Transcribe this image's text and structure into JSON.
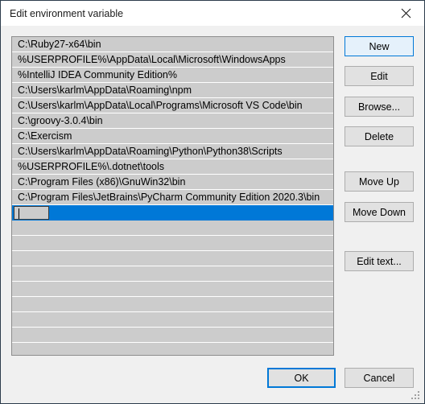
{
  "window": {
    "title": "Edit environment variable",
    "close_icon": "close-icon"
  },
  "path_list": {
    "entries": [
      "C:\\Ruby27-x64\\bin",
      "%USERPROFILE%\\AppData\\Local\\Microsoft\\WindowsApps",
      "%IntelliJ IDEA Community Edition%",
      "C:\\Users\\karlm\\AppData\\Roaming\\npm",
      "C:\\Users\\karlm\\AppData\\Local\\Programs\\Microsoft VS Code\\bin",
      "C:\\groovy-3.0.4\\bin",
      "C:\\Exercism",
      "C:\\Users\\karlm\\AppData\\Roaming\\Python\\Python38\\Scripts",
      "%USERPROFILE%\\.dotnet\\tools",
      "C:\\Program Files (x86)\\GnuWin32\\bin",
      "C:\\Program Files\\JetBrains\\PyCharm Community Edition 2020.3\\bin"
    ],
    "selected_row_value": "",
    "selected_row_index": 11,
    "empty_rows_after": 8,
    "selection_color": "#0078d7",
    "row_background": "#cccccc"
  },
  "side_buttons": [
    {
      "id": "new",
      "label": "New",
      "state": "focused"
    },
    {
      "id": "edit",
      "label": "Edit",
      "state": "normal"
    },
    {
      "id": "browse",
      "label": "Browse...",
      "state": "normal"
    },
    {
      "id": "delete",
      "label": "Delete",
      "state": "normal"
    },
    {
      "id": "move-up",
      "label": "Move Up",
      "state": "normal"
    },
    {
      "id": "move-down",
      "label": "Move Down",
      "state": "normal"
    },
    {
      "id": "edit-text",
      "label": "Edit text...",
      "state": "normal"
    }
  ],
  "bottom_buttons": {
    "ok_label": "OK",
    "cancel_label": "Cancel"
  },
  "colors": {
    "accent": "#0078d7",
    "focus_fill": "#e5f1fb",
    "dialog_background": "#f0f0f0",
    "titlebar_background": "#ffffff",
    "button_face": "#e1e1e1"
  }
}
